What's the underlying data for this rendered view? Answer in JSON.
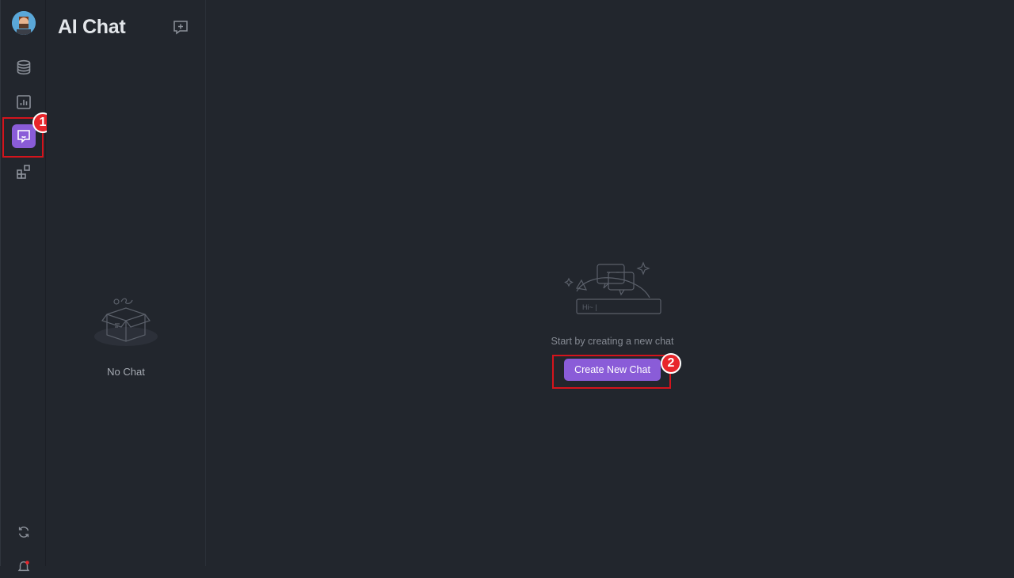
{
  "sidebar": {
    "avatar_name": "user-avatar",
    "items": [
      {
        "name": "database-icon"
      },
      {
        "name": "chart-icon"
      },
      {
        "name": "ai-chat-icon",
        "active": true
      },
      {
        "name": "apps-icon"
      }
    ],
    "bottom_items": [
      {
        "name": "sync-icon"
      },
      {
        "name": "notification-icon"
      }
    ]
  },
  "chat_panel": {
    "title": "AI Chat",
    "new_chat_icon": "new-chat-icon",
    "empty_label": "No Chat"
  },
  "main": {
    "hint": "Start by creating a new chat",
    "create_button_label": "Create New Chat",
    "illustration_text": "Hi~ |"
  },
  "annotations": [
    {
      "label": "1"
    },
    {
      "label": "2"
    }
  ],
  "colors": {
    "background": "#22262d",
    "accent": "#8a5cd8",
    "highlight": "#d4141c",
    "badge": "#e8252b"
  }
}
